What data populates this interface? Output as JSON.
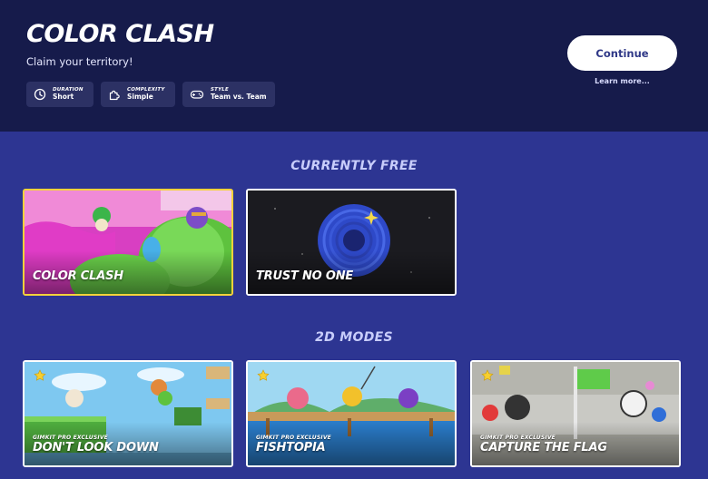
{
  "header": {
    "title": "COLOR CLASH",
    "subtitle": "Claim your territory!",
    "chips": [
      {
        "key": "DURATION",
        "value": "Short",
        "icon": "clock-icon"
      },
      {
        "key": "COMPLEXITY",
        "value": "Simple",
        "icon": "puzzle-icon"
      },
      {
        "key": "STYLE",
        "value": "Team vs. Team",
        "icon": "gamepad-icon"
      }
    ],
    "continue_label": "Continue",
    "learn_more": "Learn more..."
  },
  "sections": [
    {
      "title": "CURRENTLY FREE",
      "cards": [
        {
          "name": "COLOR CLASH",
          "selected": true
        },
        {
          "name": "TRUST NO ONE"
        }
      ]
    },
    {
      "title": "2D MODES",
      "cards": [
        {
          "name": "DON'T LOOK DOWN",
          "tag": "GIMKIT PRO EXCLUSIVE",
          "icon": "star-icon"
        },
        {
          "name": "FISHTOPIA",
          "tag": "GIMKIT PRO EXCLUSIVE",
          "icon": "star-icon"
        },
        {
          "name": "CAPTURE THE FLAG",
          "tag": "GIMKIT PRO EXCLUSIVE",
          "icon": "star-icon"
        }
      ]
    }
  ],
  "colors": {
    "header_bg": "#161b4b",
    "page_bg": "#2d3592",
    "selected_border": "#f3d23b",
    "accent": "#2f3887"
  }
}
